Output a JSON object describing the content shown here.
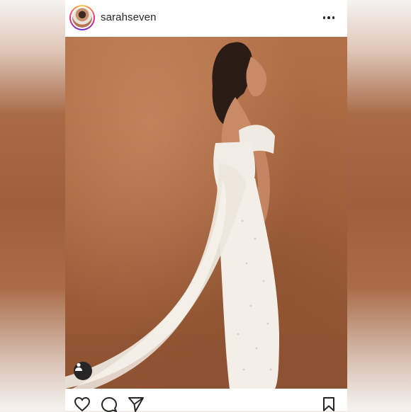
{
  "post": {
    "username": "sarahseven",
    "avatar_icon": "profile-avatar",
    "more_icon": "more-options-icon"
  },
  "photo": {
    "tag_icon": "user-tag-icon"
  },
  "actions": {
    "like_icon": "heart-icon",
    "comment_icon": "comment-icon",
    "share_icon": "paper-plane-icon",
    "save_icon": "bookmark-icon"
  }
}
